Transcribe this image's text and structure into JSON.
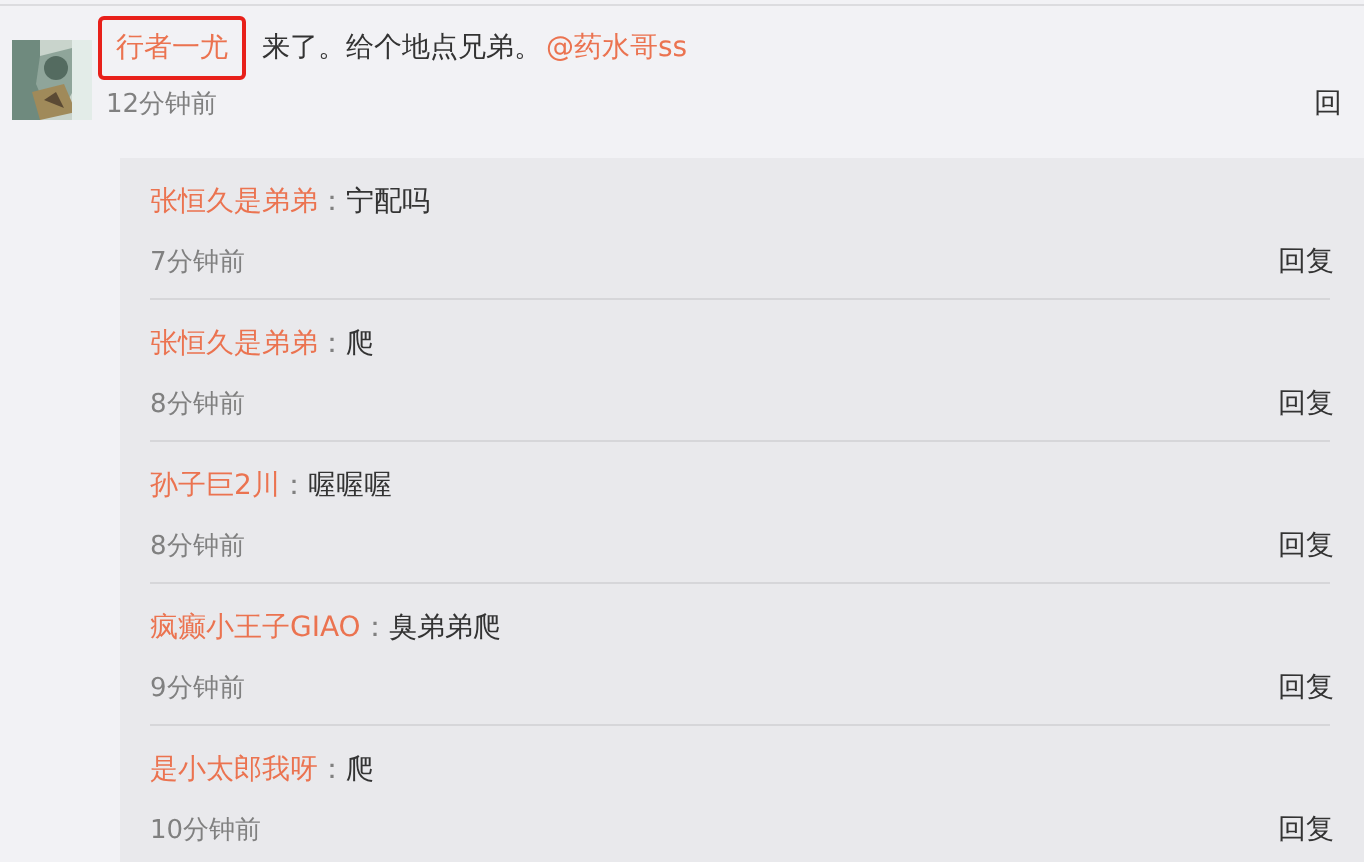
{
  "comment": {
    "user": {
      "name": "行者一尤",
      "highlighted": true
    },
    "text": "来了。给个地点兄弟。",
    "mention": "@药水哥ss",
    "time": "12分钟前",
    "reply_button": "回"
  },
  "replies": [
    {
      "user": "张恒久是弟弟",
      "separator": "：",
      "text": "宁配吗",
      "time": "7分钟前",
      "reply_button": "回复"
    },
    {
      "user": "张恒久是弟弟",
      "separator": "：",
      "text": "爬",
      "time": "8分钟前",
      "reply_button": "回复"
    },
    {
      "user": "孙子巨2川",
      "separator": "：",
      "text": "喔喔喔",
      "time": "8分钟前",
      "reply_button": "回复"
    },
    {
      "user": "疯癫小王子GIAO",
      "separator": "：",
      "text": "臭弟弟爬",
      "time": "9分钟前",
      "reply_button": "回复"
    },
    {
      "user": "是小太郎我呀",
      "separator": "：",
      "text": "爬",
      "time": "10分钟前",
      "reply_button": "回复"
    }
  ]
}
